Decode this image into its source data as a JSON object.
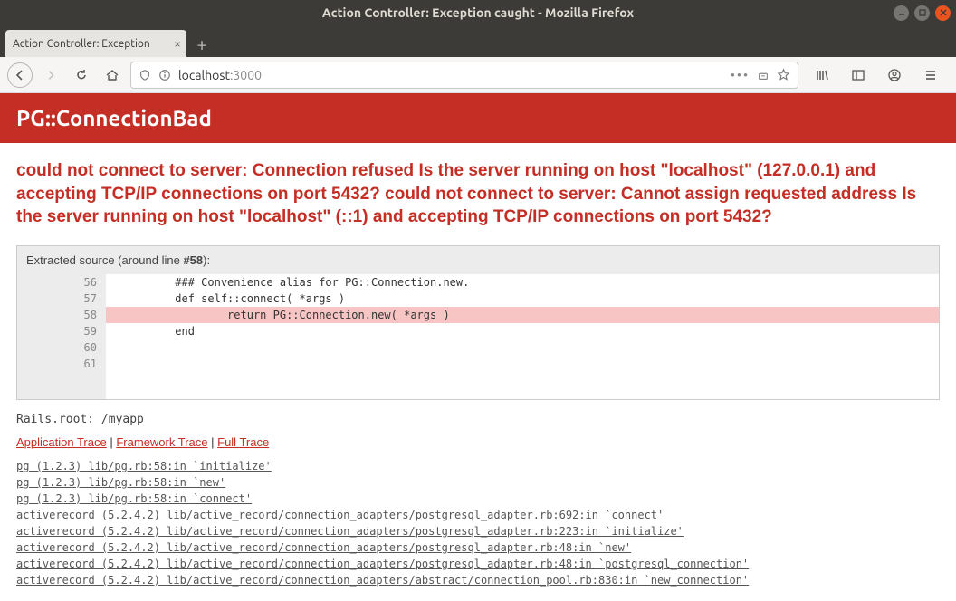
{
  "window": {
    "title": "Action Controller: Exception caught - Mozilla Firefox"
  },
  "tab": {
    "label": "Action Controller: Exception"
  },
  "url": {
    "host": "localhost",
    "port": ":3000"
  },
  "error": {
    "header": "PG::ConnectionBad",
    "message": "could not connect to server: Connection refused Is the server running on host \"localhost\" (127.0.0.1) and accepting TCP/IP connections on port 5432? could not connect to server: Cannot assign requested address Is the server running on host \"localhost\" (::1) and accepting TCP/IP connections on port 5432?"
  },
  "source": {
    "label_pre": "Extracted source (around line ",
    "label_line": "#58",
    "label_post": "):",
    "gutter": [
      "56",
      "57",
      "58",
      "59",
      "60",
      "61"
    ],
    "lines": [
      "          ### Convenience alias for PG::Connection.new.",
      "          def self::connect( *args )",
      "                  return PG::Connection.new( *args )",
      "          end",
      "",
      ""
    ],
    "highlight_index": 2
  },
  "rails_root": "Rails.root: /myapp",
  "trace": {
    "app": "Application Trace",
    "framework": "Framework Trace",
    "full": "Full Trace"
  },
  "stack": [
    "pg (1.2.3) lib/pg.rb:58:in `initialize'",
    "pg (1.2.3) lib/pg.rb:58:in `new'",
    "pg (1.2.3) lib/pg.rb:58:in `connect'",
    "activerecord (5.2.4.2) lib/active_record/connection_adapters/postgresql_adapter.rb:692:in `connect'",
    "activerecord (5.2.4.2) lib/active_record/connection_adapters/postgresql_adapter.rb:223:in `initialize'",
    "activerecord (5.2.4.2) lib/active_record/connection_adapters/postgresql_adapter.rb:48:in `new'",
    "activerecord (5.2.4.2) lib/active_record/connection_adapters/postgresql_adapter.rb:48:in `postgresql_connection'",
    "activerecord (5.2.4.2) lib/active_record/connection_adapters/abstract/connection_pool.rb:830:in `new_connection'"
  ]
}
